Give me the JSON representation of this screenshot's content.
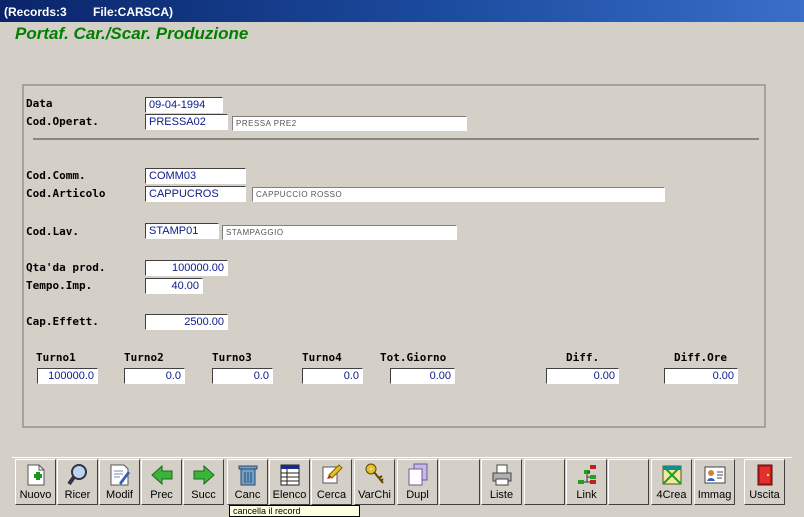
{
  "window": {
    "records_label": "(Records:3",
    "file_label": "File:CARSCA)"
  },
  "app_title": "Portaf. Car./Scar. Produzione",
  "form": {
    "data": {
      "label": "Data",
      "value": "09-04-1994"
    },
    "operatore": {
      "label": "Cod.Operat.",
      "value": "PRESSA02",
      "desc": "PRESSA PRE2"
    },
    "commessa": {
      "label": "Cod.Comm.",
      "value": "COMM03"
    },
    "articolo": {
      "label": "Cod.Articolo",
      "value": "CAPPUCROS",
      "desc": "CAPPUCCIO ROSSO"
    },
    "lavorazione": {
      "label": "Cod.Lav.",
      "value": "STAMP01",
      "desc": "STAMPAGGIO"
    },
    "qta_prod": {
      "label": "Qta'da prod.",
      "value": "100000.00"
    },
    "tempo_imp": {
      "label": "Tempo.Imp.",
      "value": "40.00"
    },
    "cap_effett": {
      "label": "Cap.Effett.",
      "value": "2500.00"
    },
    "turni": [
      {
        "label": "Turno1",
        "value": "100000.0"
      },
      {
        "label": "Turno2",
        "value": "0.0"
      },
      {
        "label": "Turno3",
        "value": "0.0"
      },
      {
        "label": "Turno4",
        "value": "0.0"
      },
      {
        "label": "Tot.Giorno",
        "value": "0.00"
      },
      {
        "label": "Diff.",
        "value": "0.00"
      },
      {
        "label": "Diff.Ore",
        "value": "0.00"
      }
    ]
  },
  "toolbar": [
    {
      "label": "Nuovo",
      "icon": "new-document-icon"
    },
    {
      "label": "Ricer",
      "icon": "magnifier-icon"
    },
    {
      "label": "Modif",
      "icon": "edit-document-icon"
    },
    {
      "label": "Prec",
      "icon": "arrow-left-icon"
    },
    {
      "label": "Succ",
      "icon": "arrow-right-icon"
    },
    {
      "label": "Canc",
      "icon": "trash-icon"
    },
    {
      "label": "Elenco",
      "icon": "list-icon"
    },
    {
      "label": "Cerca",
      "icon": "search-icon"
    },
    {
      "label": "VarChi",
      "icon": "keys-icon"
    },
    {
      "label": "Dupl",
      "icon": "duplicate-icon"
    },
    {
      "label": "",
      "icon": ""
    },
    {
      "label": "Liste",
      "icon": "printer-icon"
    },
    {
      "label": "",
      "icon": ""
    },
    {
      "label": "Link",
      "icon": "link-icon"
    },
    {
      "label": "",
      "icon": ""
    },
    {
      "label": "4Crea",
      "icon": "create-icon"
    },
    {
      "label": "Immag",
      "icon": "image-card-icon"
    },
    {
      "label": "Uscita",
      "icon": "exit-door-icon"
    }
  ],
  "tooltip": "cancella il record"
}
